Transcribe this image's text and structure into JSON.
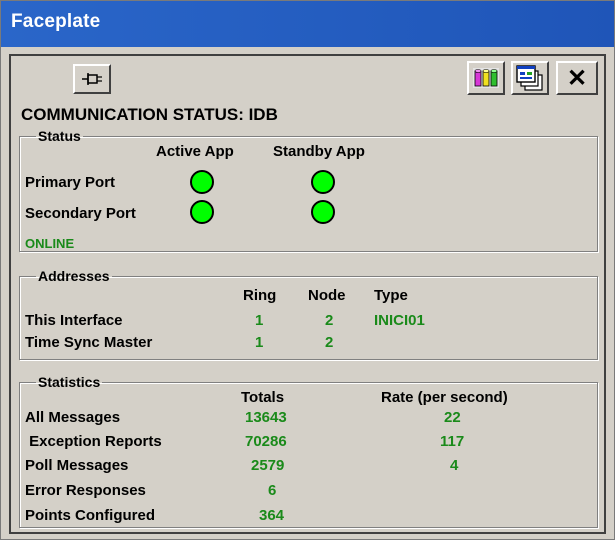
{
  "window": {
    "title": "Faceplate"
  },
  "toolbar": {
    "close_label": "✕"
  },
  "heading": "COMMUNICATION STATUS:  IDB",
  "status": {
    "legend": "Status",
    "col_active": "Active App",
    "col_standby": "Standby App",
    "row_primary": "Primary Port",
    "row_secondary": "Secondary Port",
    "led_color": "#00ff00",
    "state": "ONLINE"
  },
  "addresses": {
    "legend": "Addresses",
    "headers": {
      "ring": "Ring",
      "node": "Node",
      "type": "Type"
    },
    "rows": [
      {
        "label": "This Interface",
        "ring": "1",
        "node": "2",
        "type": "INICI01"
      },
      {
        "label": "Time Sync Master",
        "ring": "1",
        "node": "2",
        "type": ""
      }
    ]
  },
  "statistics": {
    "legend": "Statistics",
    "headers": {
      "totals": "Totals",
      "rate": "Rate (per second)"
    },
    "rows": [
      {
        "label": "All Messages",
        "total": "13643",
        "rate": "22"
      },
      {
        "label": " Exception Reports",
        "total": "70286",
        "rate": "117"
      },
      {
        "label": "Poll Messages",
        "total": "2579",
        "rate": "4"
      },
      {
        "label": "Error Responses",
        "total": "6",
        "rate": ""
      },
      {
        "label": "Points Configured",
        "total": "364",
        "rate": ""
      }
    ]
  },
  "colors": {
    "value_green": "#1a8a1a",
    "title_blue": "#2a66c9"
  }
}
